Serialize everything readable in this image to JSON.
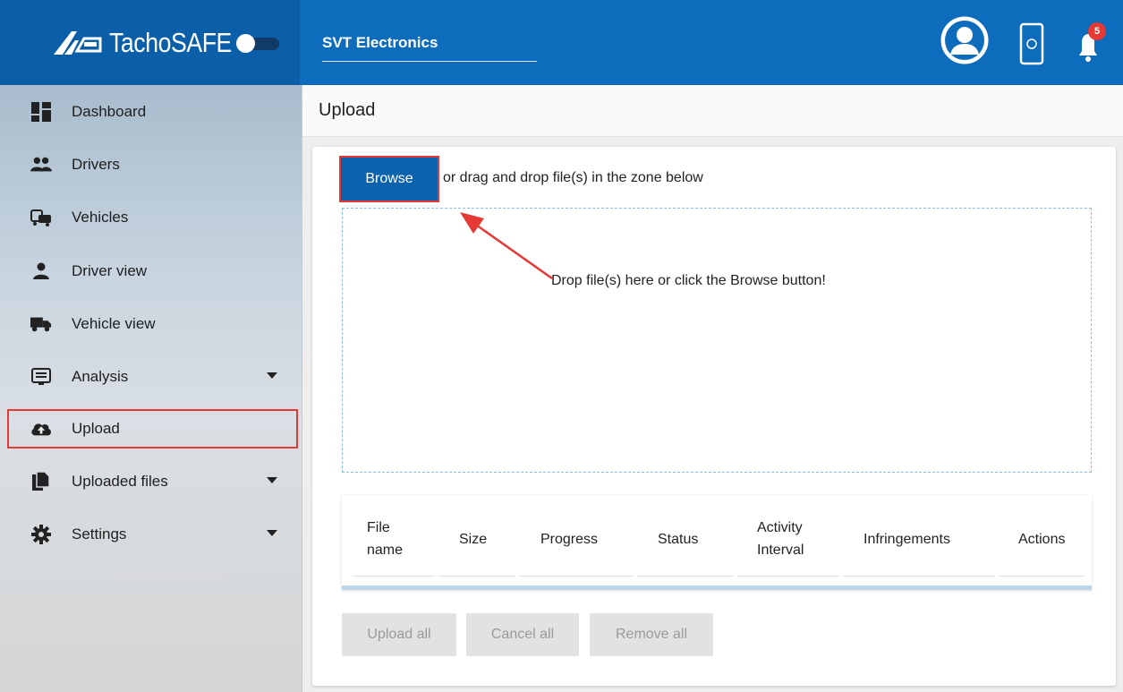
{
  "app": {
    "brand_name": "TachoSAFE",
    "company": "SVT Electronics",
    "notification_count": "5"
  },
  "sidebar": {
    "items": [
      {
        "label": "Dashboard",
        "icon": "dashboard-icon"
      },
      {
        "label": "Drivers",
        "icon": "drivers-icon"
      },
      {
        "label": "Vehicles",
        "icon": "vehicles-icon"
      },
      {
        "label": "Driver view",
        "icon": "driver-view-icon"
      },
      {
        "label": "Vehicle view",
        "icon": "truck-icon"
      },
      {
        "label": "Analysis",
        "icon": "analysis-icon",
        "expandable": true
      },
      {
        "label": "Upload",
        "icon": "cloud-upload-icon",
        "active": true
      },
      {
        "label": "Uploaded files",
        "icon": "files-icon",
        "expandable": true
      },
      {
        "label": "Settings",
        "icon": "gear-icon",
        "expandable": true
      }
    ]
  },
  "main": {
    "page_title": "Upload",
    "browse_label": "Browse",
    "browse_hint": "or drag and drop file(s) in the zone below",
    "drop_text": "Drop file(s) here or click the Browse button!",
    "table": {
      "columns": [
        {
          "line1": "File",
          "line2": "name"
        },
        {
          "line1": "Size",
          "line2": ""
        },
        {
          "line1": "Progress",
          "line2": ""
        },
        {
          "line1": "Status",
          "line2": ""
        },
        {
          "line1": "Activity",
          "line2": "Interval"
        },
        {
          "line1": "Infringements",
          "line2": ""
        },
        {
          "line1": "Actions",
          "line2": ""
        }
      ]
    },
    "actions": {
      "upload_all": "Upload all",
      "cancel_all": "Cancel all",
      "remove_all": "Remove all"
    }
  },
  "colors": {
    "header_blue": "#0d6cbb",
    "brand_blue": "#0b5ea8",
    "browse_blue": "#0d62ad",
    "highlight_red": "#e53935",
    "badge_red": "#e53935"
  }
}
